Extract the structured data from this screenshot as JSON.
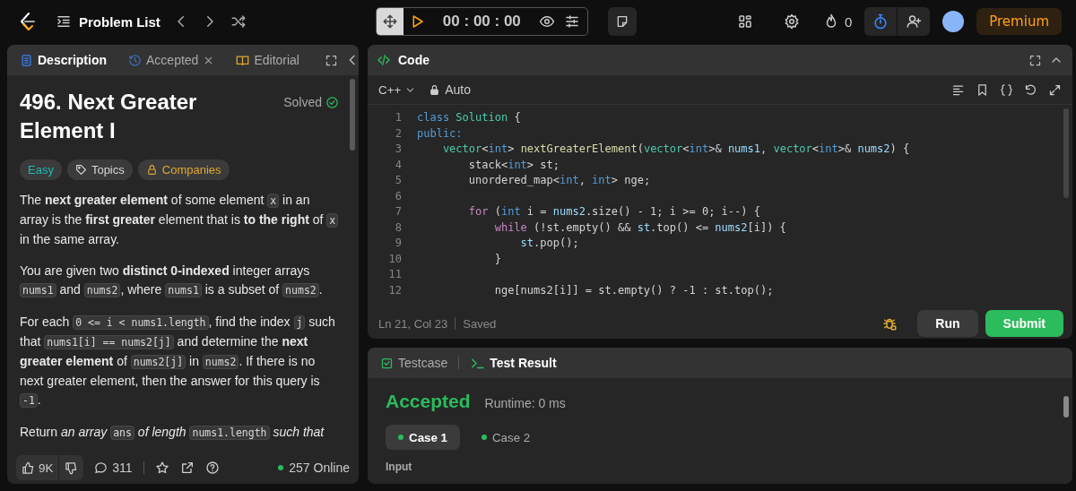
{
  "top_bar": {
    "problem_list": "Problem List",
    "timer": "00 : 00 : 00",
    "streak": "0",
    "premium": "Premium"
  },
  "description_panel": {
    "tabs": [
      {
        "label": "Description",
        "selected": true,
        "kind": "description",
        "closable": false
      },
      {
        "label": "Accepted",
        "selected": false,
        "kind": "submission",
        "closable": true
      },
      {
        "label": "Editorial",
        "selected": false,
        "kind": "editorial",
        "closable": false
      }
    ],
    "title": "496. Next Greater Element I",
    "status": "Solved",
    "tags": [
      {
        "label": "Easy",
        "kind": "difficulty",
        "color": "#1cb8b8"
      },
      {
        "label": "Topics",
        "kind": "topics",
        "color": "#d6d6d6"
      },
      {
        "label": "Companies",
        "kind": "companies",
        "color": "#e0a92e"
      }
    ],
    "paragraphs": [
      [
        {
          "kind": "text",
          "text": "The **next greater element** of some element "
        },
        {
          "kind": "code",
          "text": "x"
        },
        {
          "kind": "text",
          "text": " in an array is the **first greater** element that is **to the right** of "
        },
        {
          "kind": "code",
          "text": "x"
        },
        {
          "kind": "text",
          "text": " in the same array."
        }
      ],
      [
        {
          "kind": "text",
          "text": "You are given two **distinct 0-indexed** integer arrays "
        },
        {
          "kind": "code",
          "text": "nums1"
        },
        {
          "kind": "text",
          "text": " and "
        },
        {
          "kind": "code",
          "text": "nums2"
        },
        {
          "kind": "text",
          "text": ", where "
        },
        {
          "kind": "code",
          "text": "nums1"
        },
        {
          "kind": "text",
          "text": " is a subset of "
        },
        {
          "kind": "code",
          "text": "nums2"
        },
        {
          "kind": "text",
          "text": "."
        }
      ],
      [
        {
          "kind": "text",
          "text": "For each "
        },
        {
          "kind": "code",
          "text": "0 <= i < nums1.length"
        },
        {
          "kind": "text",
          "text": ", find the index "
        },
        {
          "kind": "code",
          "text": "j"
        },
        {
          "kind": "text",
          "text": " such that "
        },
        {
          "kind": "code",
          "text": "nums1[i] == nums2[j]"
        },
        {
          "kind": "text",
          "text": " and determine the **next greater element** of "
        },
        {
          "kind": "code",
          "text": "nums2[j]"
        },
        {
          "kind": "text",
          "text": " in "
        },
        {
          "kind": "code",
          "text": "nums2"
        },
        {
          "kind": "text",
          "text": ". If there is no next greater element, then the answer for this query is "
        },
        {
          "kind": "code",
          "text": "-1"
        },
        {
          "kind": "text",
          "text": "."
        }
      ],
      [
        {
          "kind": "text",
          "text": "Return *an array* "
        },
        {
          "kind": "code",
          "text": "ans"
        },
        {
          "kind": "text",
          "text": " *of length* "
        },
        {
          "kind": "code",
          "text": "nums1.length"
        },
        {
          "kind": "text",
          "text": " *such that*"
        }
      ]
    ],
    "footer": {
      "likes": "9K",
      "comments": "311",
      "online": "257 Online"
    }
  },
  "code_panel": {
    "title": "Code",
    "language": "C++",
    "mode": "Auto",
    "lines": [
      {
        "number": "1",
        "tokens": [
          {
            "text": "class ",
            "kind": "keyword"
          },
          {
            "text": "Solution",
            "kind": "type"
          },
          {
            "text": " {",
            "kind": "plain"
          }
        ]
      },
      {
        "number": "2",
        "tokens": [
          {
            "text": "public:",
            "kind": "keyword"
          }
        ]
      },
      {
        "number": "3",
        "tokens": [
          {
            "text": "    vector",
            "kind": "type"
          },
          {
            "text": "<",
            "kind": "plain"
          },
          {
            "text": "int",
            "kind": "keyword"
          },
          {
            "text": "> ",
            "kind": "plain"
          },
          {
            "text": "nextGreaterElement",
            "kind": "function"
          },
          {
            "text": "(",
            "kind": "plain"
          },
          {
            "text": "vector",
            "kind": "type"
          },
          {
            "text": "<",
            "kind": "plain"
          },
          {
            "text": "int",
            "kind": "keyword"
          },
          {
            "text": ">& ",
            "kind": "plain"
          },
          {
            "text": "nums1",
            "kind": "variable"
          },
          {
            "text": ", ",
            "kind": "plain"
          },
          {
            "text": "vector",
            "kind": "type"
          },
          {
            "text": "<",
            "kind": "plain"
          },
          {
            "text": "int",
            "kind": "keyword"
          },
          {
            "text": ">& ",
            "kind": "plain"
          },
          {
            "text": "nums2",
            "kind": "variable"
          },
          {
            "text": ") {",
            "kind": "plain"
          }
        ]
      },
      {
        "number": "4",
        "tokens": [
          {
            "text": "        stack<",
            "kind": "plain"
          },
          {
            "text": "int",
            "kind": "keyword"
          },
          {
            "text": "> st;",
            "kind": "plain"
          }
        ]
      },
      {
        "number": "5",
        "tokens": [
          {
            "text": "        unordered_map<",
            "kind": "plain"
          },
          {
            "text": "int",
            "kind": "keyword"
          },
          {
            "text": ", ",
            "kind": "plain"
          },
          {
            "text": "int",
            "kind": "keyword"
          },
          {
            "text": "> nge;",
            "kind": "plain"
          }
        ]
      },
      {
        "number": "6"
      },
      {
        "number": "7",
        "tokens": [
          {
            "text": "        for",
            "kind": "control"
          },
          {
            "text": " (",
            "kind": "plain"
          },
          {
            "text": "int",
            "kind": "keyword"
          },
          {
            "text": " i = ",
            "kind": "plain"
          },
          {
            "text": "nums2",
            "kind": "variable"
          },
          {
            "text": ".size() - 1; i >= 0; i--) {",
            "kind": "plain"
          }
        ]
      },
      {
        "number": "8",
        "tokens": [
          {
            "text": "            while",
            "kind": "control"
          },
          {
            "text": " (!st.empty() && ",
            "kind": "plain"
          },
          {
            "text": "st",
            "kind": "variable"
          },
          {
            "text": ".top() <= ",
            "kind": "plain"
          },
          {
            "text": "nums2",
            "kind": "variable"
          },
          {
            "text": "[i]) {",
            "kind": "plain"
          }
        ]
      },
      {
        "number": "9",
        "tokens": [
          {
            "text": "                st",
            "kind": "variable"
          },
          {
            "text": ".pop();",
            "kind": "plain"
          }
        ]
      },
      {
        "number": "10",
        "tokens": [
          {
            "text": "            }",
            "kind": "plain"
          }
        ]
      },
      {
        "number": "11"
      },
      {
        "number": "12",
        "tokens": [
          {
            "text": "            nge[nums2[i]] = st.empty() ? -1 : st.top();",
            "kind": "plain"
          }
        ]
      }
    ],
    "cursor": "Ln 21, Col 23",
    "save_state": "Saved",
    "run": "Run",
    "submit": "Submit"
  },
  "test_panel": {
    "tabs": [
      {
        "label": "Testcase",
        "selected": false,
        "kind": "testcase"
      },
      {
        "label": "Test Result",
        "selected": true,
        "kind": "result"
      }
    ],
    "verdict": "Accepted",
    "runtime": "Runtime: 0 ms",
    "cases": [
      {
        "label": "Case 1",
        "selected": true
      },
      {
        "label": "Case 2",
        "selected": false
      }
    ],
    "input_label": "Input"
  }
}
